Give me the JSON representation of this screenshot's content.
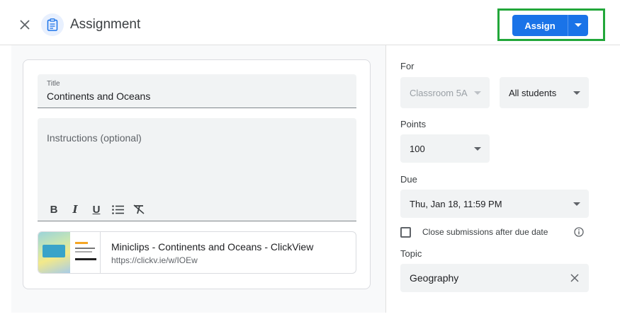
{
  "header": {
    "title": "Assignment",
    "assign_label": "Assign"
  },
  "form": {
    "title_label": "Title",
    "title_value": "Continents and Oceans",
    "instructions_placeholder": "Instructions (optional)",
    "format_buttons": [
      "B",
      "I",
      "U"
    ]
  },
  "attachment": {
    "title": "Miniclips - Continents and Oceans - ClickView",
    "url": "https://clickv.ie/w/IOEw"
  },
  "sidebar": {
    "for_label": "For",
    "class_value": "Classroom 5A",
    "students_value": "All students",
    "points_label": "Points",
    "points_value": "100",
    "due_label": "Due",
    "due_value": "Thu, Jan 18, 11:59 PM",
    "close_submissions_label": "Close submissions after due date",
    "close_submissions_checked": false,
    "topic_label": "Topic",
    "topic_value": "Geography"
  },
  "colors": {
    "accent": "#1a73e8",
    "highlight": "#22a73a"
  },
  "icons": [
    "close-icon",
    "assignment-icon",
    "chevron-down-icon",
    "bulleted-list-icon",
    "clear-formatting-icon",
    "info-icon",
    "clear-icon"
  ]
}
